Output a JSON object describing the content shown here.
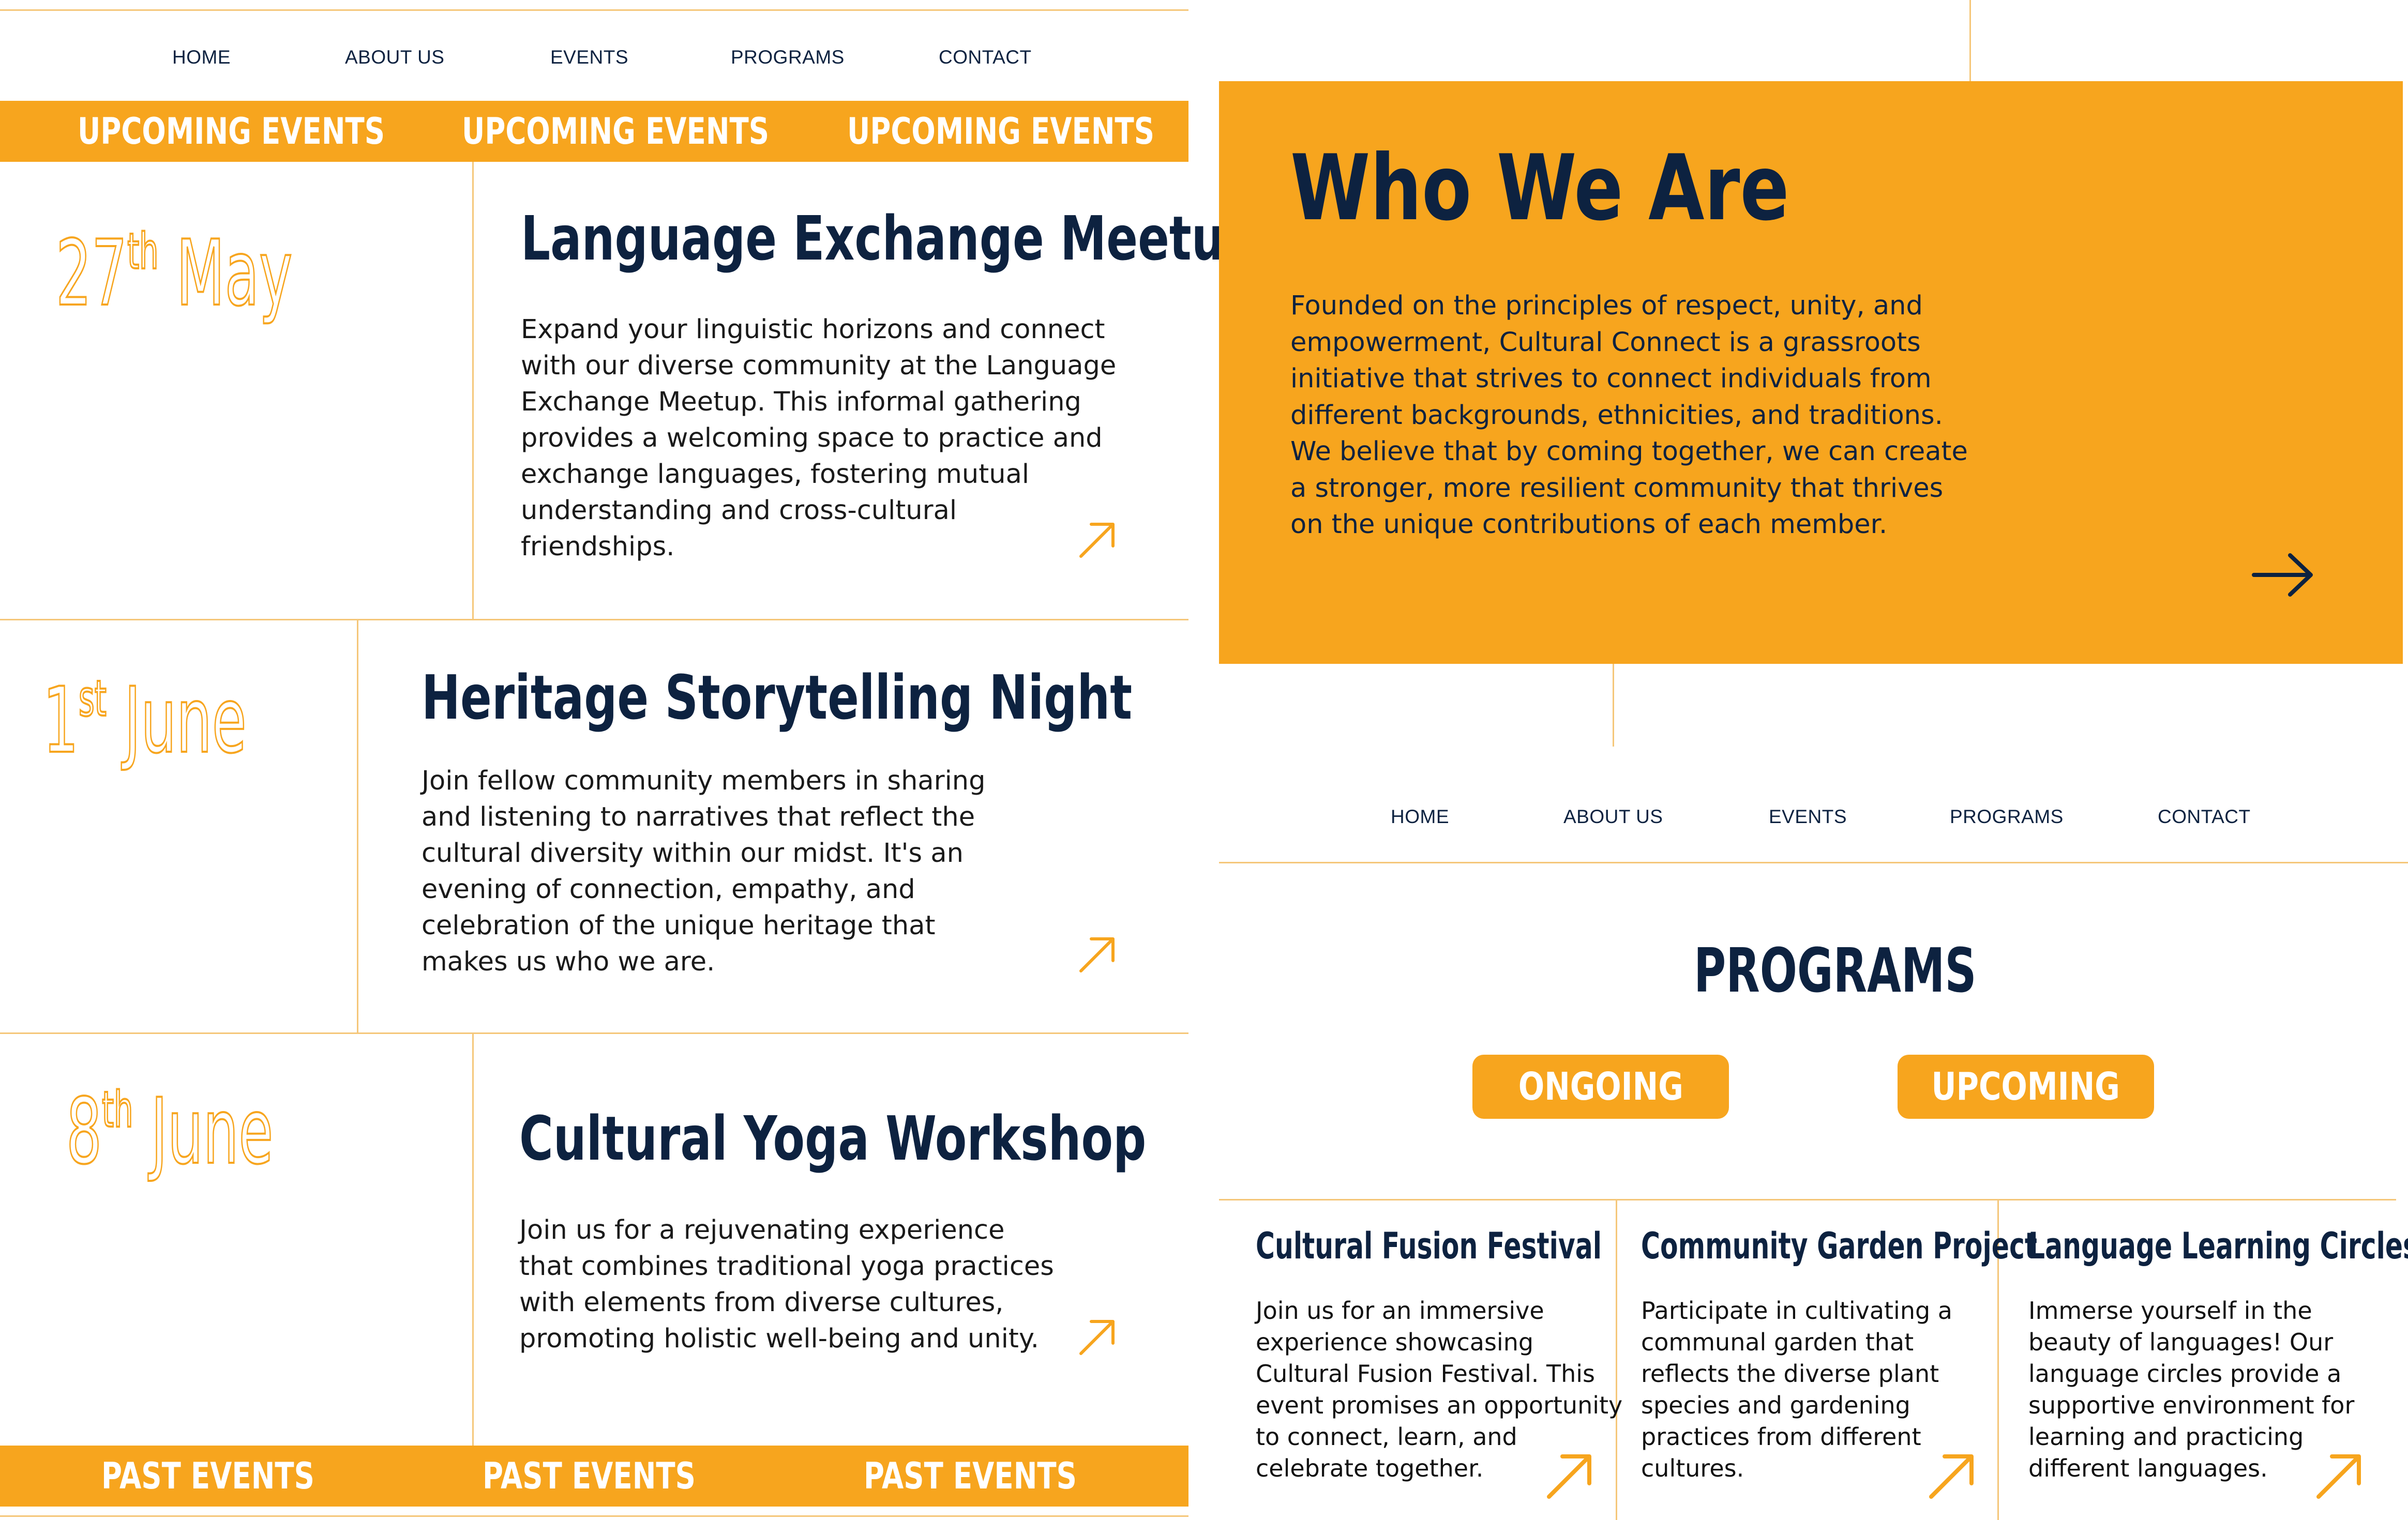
{
  "colors": {
    "accent": "#f7a51e",
    "navy": "#0d2240",
    "line": "#f5c77a"
  },
  "icons": {
    "event_arrow": "arrow-up-right-icon",
    "who_arrow": "arrow-right-icon"
  },
  "left": {
    "nav": [
      "HOME",
      "ABOUT US",
      "EVENTS",
      "PROGRAMS",
      "CONTACT"
    ],
    "upcoming_banner": [
      "UPCOMING EVENTS",
      "UPCOMING EVENTS",
      "UPCOMING EVENTS"
    ],
    "events": [
      {
        "day": "27",
        "suffix": "th",
        "month": "May",
        "title": "Language Exchange Meetup",
        "description": "Expand your linguistic horizons and connect\nwith our diverse community at the Language\nExchange Meetup. This informal gathering\nprovides a welcoming space to practice and\nexchange languages, fostering mutual\nunderstanding and cross-cultural\nfriendships."
      },
      {
        "day": "1",
        "suffix": "st",
        "month": "June",
        "title": "Heritage Storytelling Night",
        "description": "Join fellow community members in sharing\nand listening to narratives that reflect the\ncultural diversity within our midst. It's an\nevening of connection, empathy, and\ncelebration of the unique heritage that\nmakes us who we are."
      },
      {
        "day": "8",
        "suffix": "th",
        "month": "June",
        "title": "Cultural Yoga Workshop",
        "description": " Join us for a rejuvenating experience\nthat combines traditional yoga practices\nwith elements from diverse cultures,\npromoting holistic well-being and unity."
      }
    ],
    "past_banner": [
      "PAST EVENTS",
      "PAST EVENTS",
      "PAST EVENTS"
    ]
  },
  "who": {
    "title": "Who We Are",
    "text": "Founded on the principles of respect, unity, and\nempowerment, Cultural Connect is a grassroots\ninitiative that strives to connect individuals from\ndifferent backgrounds, ethnicities, and traditions.\nWe believe that by coming together, we can create\na stronger, more resilient community that thrives\non the unique contributions of each member."
  },
  "programs": {
    "nav": [
      "HOME",
      "ABOUT US",
      "EVENTS",
      "PROGRAMS",
      "CONTACT"
    ],
    "heading": "PROGRAMS",
    "tabs": [
      "ONGOING",
      "UPCOMING"
    ],
    "cards": [
      {
        "title": "Cultural Fusion Festival",
        "description": "Join us for an immersive\nexperience showcasing\nCultural Fusion Festival. This\nevent promises an opportunity\nto connect, learn, and\ncelebrate together."
      },
      {
        "title": "Community Garden Project",
        "description": "Participate in cultivating a\ncommunal garden that\nreflects the diverse plant\nspecies and gardening\npractices from different\ncultures."
      },
      {
        "title": "Language Learning Circles",
        "description": "Immerse yourself in the\nbeauty of languages! Our\nlanguage circles provide a\nsupportive environment for\nlearning and practicing\ndifferent languages."
      }
    ]
  }
}
